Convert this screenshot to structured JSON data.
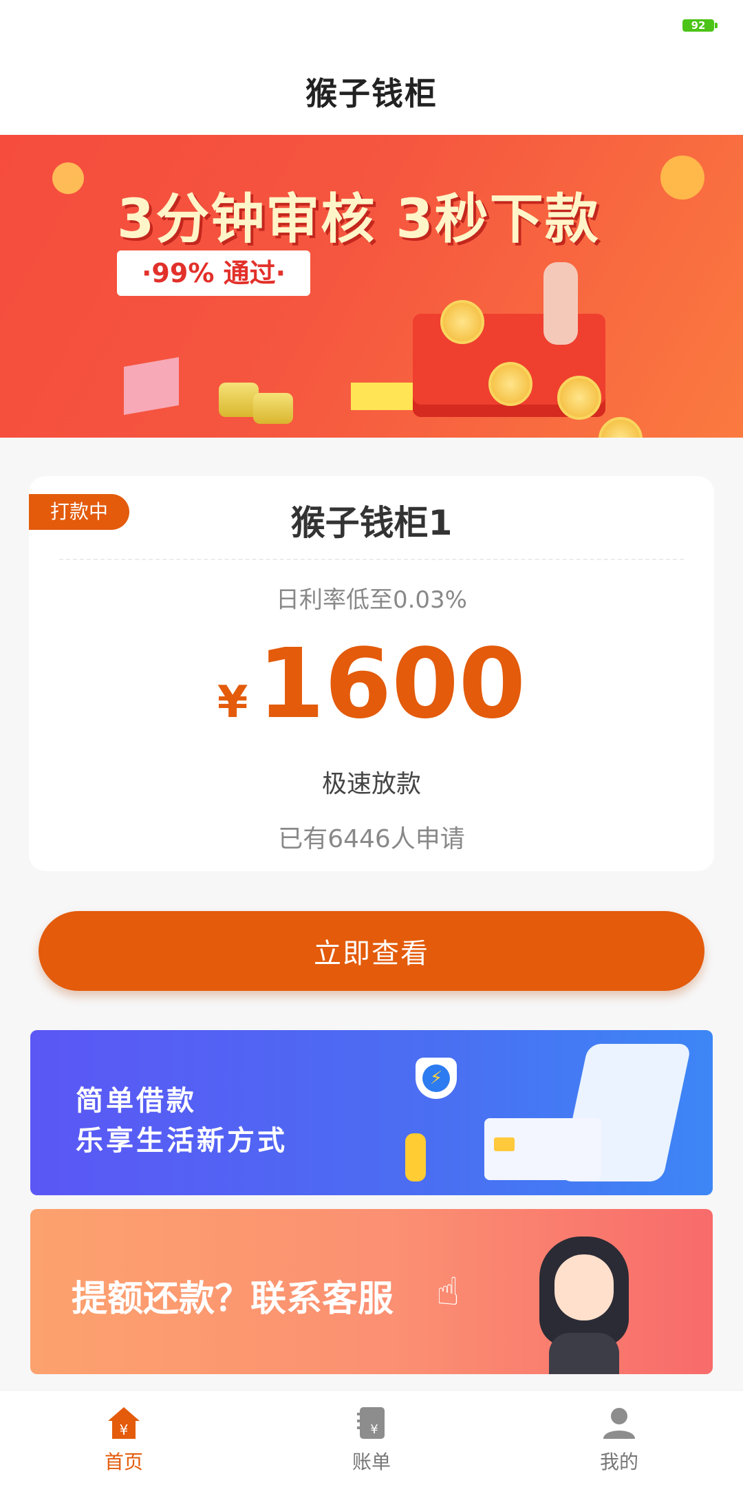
{
  "status_bar": {
    "battery": "92"
  },
  "app": {
    "title": "猴子钱柜"
  },
  "banner": {
    "headline": "3分钟审核 3秒下款",
    "subline": "·99% 通过·"
  },
  "product_card": {
    "badge": "打款中",
    "name": "猴子钱柜1",
    "rate": "日利率低至0.03%",
    "currency": "¥",
    "amount": "1600",
    "feature": "极速放款",
    "applicants": "已有6446人申请"
  },
  "cta": {
    "label": "立即查看"
  },
  "promo1": {
    "line1": "简单借款",
    "line2": "乐享生活新方式"
  },
  "promo2": {
    "text": "提额还款？联系客服"
  },
  "tabbar": {
    "items": [
      {
        "label": "首页",
        "icon": "home-yen-icon",
        "active": true
      },
      {
        "label": "账单",
        "icon": "bill-icon",
        "active": false
      },
      {
        "label": "我的",
        "icon": "user-icon",
        "active": false
      }
    ]
  },
  "colors": {
    "accent": "#e35b0b",
    "banner_red": "#f54c3e",
    "promo_blue": "#4a6ff2",
    "promo_orange": "#fb8f72"
  }
}
